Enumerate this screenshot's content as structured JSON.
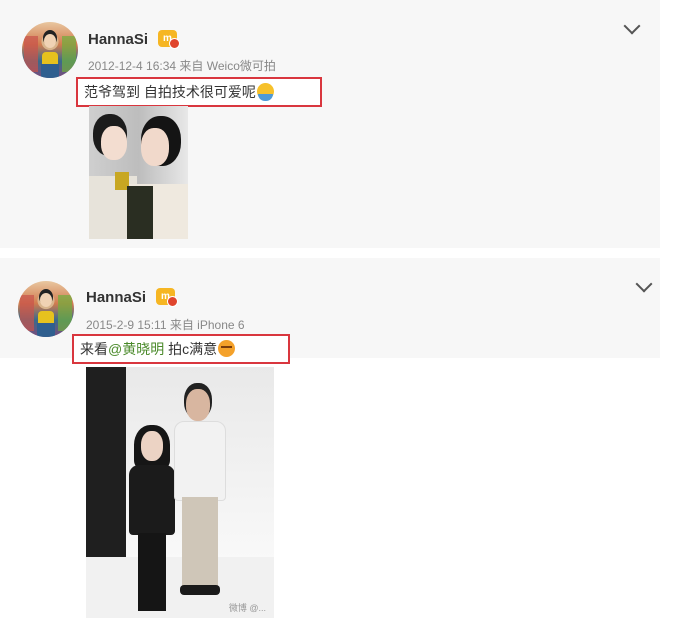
{
  "posts": [
    {
      "username": "HannaSi",
      "vip_badge_text": "m",
      "meta": "2012-12-4 16:34 来自 Weico微可拍",
      "text_before": "范爷驾到 自拍技术很可爱呢",
      "emoji": "hug-emoji",
      "image": "selfie-photo"
    },
    {
      "username": "HannaSi",
      "vip_badge_text": "m",
      "meta": "2015-2-9 15:11 来自 iPhone 6",
      "text_before": "来看",
      "mention": "@黄晓明",
      "text_after": " 拍c满意",
      "emoji": "smug-emoji",
      "image": "studio-photo",
      "watermark": "微博 @..."
    }
  ],
  "colors": {
    "highlight_border": "#d9363e",
    "mention": "#4a8a2a",
    "meta": "#888888",
    "vip": "#f6b623"
  }
}
